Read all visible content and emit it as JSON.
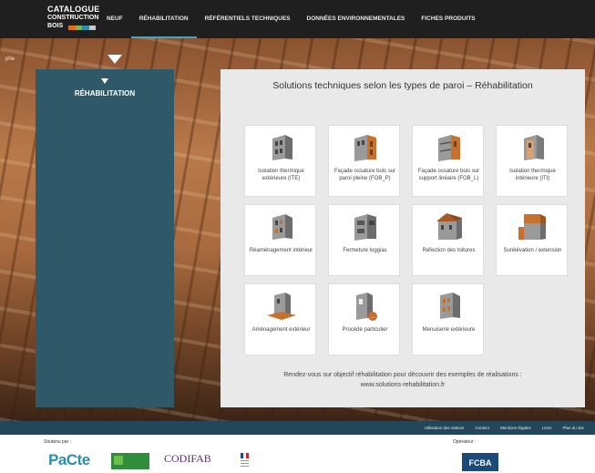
{
  "logo": {
    "line1": "CATALOGUE",
    "line2": "CONSTRUCTION",
    "line3": "BOIS",
    "colors": [
      "#e36a18",
      "#7ab648",
      "#2a8fb0",
      "#c9c9c9"
    ]
  },
  "nav": {
    "items": [
      {
        "label": "NEUF",
        "active": false
      },
      {
        "label": "RÉHABILITATION",
        "active": true
      },
      {
        "label": "RÉFÉRENTIELS TECHNIQUES",
        "active": false
      },
      {
        "label": "DONNÉES ENVIRONNEMENTALES",
        "active": false
      },
      {
        "label": "FICHES PRODUITS",
        "active": false
      }
    ],
    "active_color": "#3ea6c6"
  },
  "hero_side_text": "phe",
  "sidebar": {
    "title": "RÉHABILITATION",
    "color": "#2f5968"
  },
  "panel": {
    "title": "Solutions techniques selon les types de paroi – Réhabilitation",
    "cards": [
      {
        "label": "Isolation thermique extérieure (ITE)",
        "icon": "ite-building-icon"
      },
      {
        "label": "Façade ossature bois sur paroi pleine (FOB_P)",
        "icon": "fob-p-building-icon"
      },
      {
        "label": "Façade ossature bois sur support linéaire (FOB_L)",
        "icon": "fob-l-building-icon"
      },
      {
        "label": "Isolation thermique intérieure (ITI)",
        "icon": "iti-building-icon"
      },
      {
        "label": "Réaménagement intérieur",
        "icon": "reamenagement-building-icon"
      },
      {
        "label": "Fermeture loggias",
        "icon": "loggia-building-icon"
      },
      {
        "label": "Réfection des toitures",
        "icon": "roof-building-icon"
      },
      {
        "label": "Surélévation / extension",
        "icon": "extension-building-icon"
      },
      {
        "label": "Aménagement extérieur",
        "icon": "exterior-deck-icon"
      },
      {
        "label": "Procédé particulier",
        "icon": "special-process-icon"
      },
      {
        "label": "Menuiserie extérieure",
        "icon": "window-building-icon"
      }
    ],
    "cta_line1": "Rendez-vous sur objectif réhabilitation pour découvrir des exemples de réalisations :",
    "cta_line2": "www.solutions-rehabilitation.fr"
  },
  "footer": {
    "links": [
      "Utilisation des valeurs",
      "Contact",
      "Mentions légales",
      "Liens",
      "Plan du site"
    ],
    "support_label": "Soutenu par :",
    "operator_label": "Opérateur :",
    "operator_logo": "FCBA",
    "sponsors": [
      "PaCte",
      "CODIFAB"
    ]
  },
  "colors": {
    "wood_orange": "#c8712f",
    "building_grey": "#8d8d8d",
    "footer_bar": "#23475a"
  }
}
